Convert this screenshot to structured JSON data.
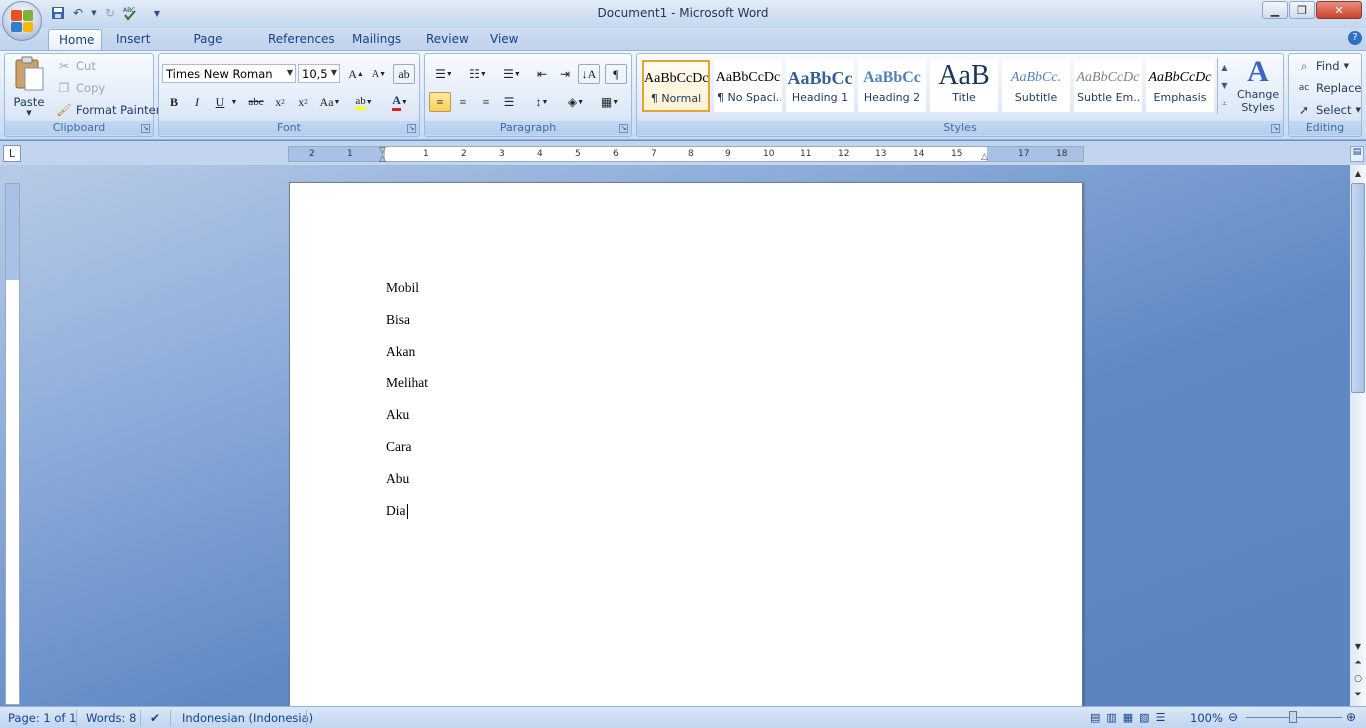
{
  "window": {
    "title": "Document1 - Microsoft Word"
  },
  "quick_access": [
    "save-icon",
    "undo-icon",
    "redo-icon",
    "spelling-icon",
    "customize-icon"
  ],
  "tabs": [
    {
      "label": "Home",
      "active": true
    },
    {
      "label": "Insert"
    },
    {
      "label": "Page Layout"
    },
    {
      "label": "References"
    },
    {
      "label": "Mailings"
    },
    {
      "label": "Review"
    },
    {
      "label": "View"
    }
  ],
  "clipboard": {
    "paste": "Paste",
    "cut": "Cut",
    "copy": "Copy",
    "format_painter": "Format Painter",
    "label": "Clipboard"
  },
  "font": {
    "name": "Times New Roman",
    "size": "10,5",
    "label": "Font"
  },
  "paragraph": {
    "label": "Paragraph"
  },
  "styles": {
    "label": "Styles",
    "items": [
      {
        "sample": "AaBbCcDc",
        "name": "¶ Normal"
      },
      {
        "sample": "AaBbCcDc",
        "name": "¶ No Spaci..."
      },
      {
        "sample": "AaBbCc",
        "name": "Heading 1"
      },
      {
        "sample": "AaBbCc",
        "name": "Heading 2"
      },
      {
        "sample": "AaB",
        "name": "Title"
      },
      {
        "sample": "AaBbCc.",
        "name": "Subtitle"
      },
      {
        "sample": "AaBbCcDc",
        "name": "Subtle Em..."
      },
      {
        "sample": "AaBbCcDc",
        "name": "Emphasis"
      }
    ],
    "change_styles": "Change Styles"
  },
  "editing": {
    "label": "Editing",
    "find": "Find",
    "replace": "Replace",
    "select": "Select"
  },
  "ruler_numbers": [
    "2",
    "1",
    "1",
    "2",
    "3",
    "4",
    "5",
    "6",
    "7",
    "8",
    "9",
    "10",
    "11",
    "12",
    "13",
    "14",
    "15",
    "17",
    "18"
  ],
  "document": {
    "lines": [
      "Mobil",
      "Bisa",
      "Akan",
      "Melihat",
      "Aku",
      "Cara",
      "Abu",
      "Dia"
    ]
  },
  "status": {
    "page": "Page: 1 of 1",
    "words": "Words: 8",
    "language": "Indonesian (Indonesia)",
    "zoom": "100%"
  }
}
